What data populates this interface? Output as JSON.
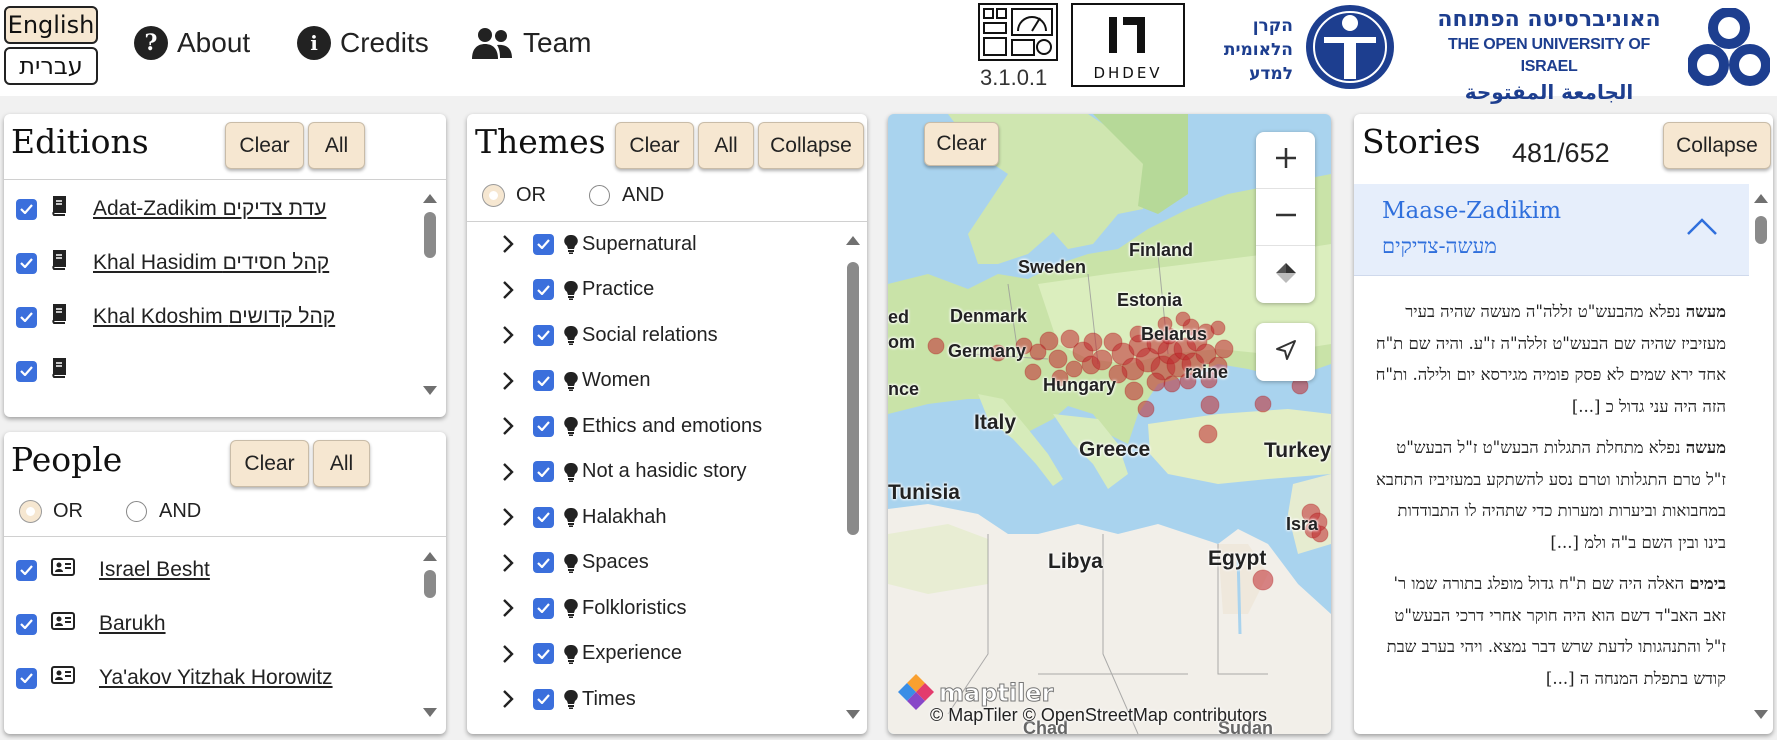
{
  "header": {
    "lang_english": "English",
    "lang_hebrew": "עברית",
    "nav": [
      {
        "label": "About",
        "icon": "question-circle-icon"
      },
      {
        "label": "Credits",
        "icon": "info-circle-icon"
      },
      {
        "label": "Team",
        "icon": "users-icon"
      }
    ],
    "version": "3.1.0.1",
    "dhdev_logo": "DHDEV",
    "isf_logo_lines": [
      "הקרן",
      "הלאומית",
      "למדע"
    ],
    "openu_logo": {
      "hebrew": "האוניברסיטה הפתוחה",
      "english": "THE OPEN UNIVERSITY OF ISRAEL",
      "arabic": "الجامعة المفتوحة"
    }
  },
  "editions": {
    "title": "Editions",
    "clear_label": "Clear",
    "all_label": "All",
    "items": [
      {
        "label": "Adat-Zadikim עדת צדיקים",
        "checked": true
      },
      {
        "label": "Khal Hasidim קהל חסידים",
        "checked": true
      },
      {
        "label": "Khal Kdoshim קהל קדושים",
        "checked": true
      },
      {
        "label": "",
        "checked": true
      }
    ]
  },
  "people": {
    "title": "People",
    "clear_label": "Clear",
    "all_label": "All",
    "or_label": "OR",
    "and_label": "AND",
    "mode": "OR",
    "items": [
      {
        "label": "Israel Besht",
        "checked": true
      },
      {
        "label": "Barukh",
        "checked": true
      },
      {
        "label": "Ya'akov Yitzhak Horowitz",
        "checked": true
      }
    ]
  },
  "themes": {
    "title": "Themes",
    "clear_label": "Clear",
    "all_label": "All",
    "collapse_label": "Collapse",
    "or_label": "OR",
    "and_label": "AND",
    "mode": "OR",
    "items": [
      {
        "label": "Supernatural",
        "checked": true
      },
      {
        "label": "Practice",
        "checked": true
      },
      {
        "label": "Social relations",
        "checked": true
      },
      {
        "label": "Women",
        "checked": true
      },
      {
        "label": "Ethics and emotions",
        "checked": true
      },
      {
        "label": "Not a hasidic story",
        "checked": true
      },
      {
        "label": "Halakhah",
        "checked": true
      },
      {
        "label": "Spaces",
        "checked": true
      },
      {
        "label": "Folkloristics",
        "checked": true
      },
      {
        "label": "Experience",
        "checked": true
      },
      {
        "label": "Times",
        "checked": true
      }
    ]
  },
  "map": {
    "clear_label": "Clear",
    "zoom_in": "+",
    "zoom_out": "−",
    "labels": [
      "Finland",
      "Sweden",
      "Estonia",
      "Denmark",
      "Germany",
      "Belarus",
      "Ukraine",
      "Hungary",
      "Italy",
      "Greece",
      "Turkey",
      "Tunisia",
      "Libya",
      "Egypt",
      "Israel",
      "France",
      "Chad",
      "Sudan"
    ],
    "label_fragments": {
      "France": "nce",
      "Ukraine": "raine",
      "Turkey": "Turkey",
      "Israel": "Isra",
      "Chad": "Chad",
      "Sudan": "Sudan",
      "left_edge_1": "ed",
      "left_edge_2": "om"
    },
    "attribution": "© MapTiler © OpenStreetMap contributors",
    "logo": "maptiler",
    "marker_color": "#c0282d"
  },
  "stories": {
    "title": "Stories",
    "count": "481/652",
    "collapse_label": "Collapse",
    "current": {
      "title_en": "Maase-Zadikim",
      "title_he": "מעשה-צדיקים"
    },
    "entries": [
      {
        "lead": "מעשה",
        "text": "נפלא מהבעש\"ט זללה\"ה מעשה שהיה בעיר מעזיביז שהיה שם הבעש\"ט זללה\"ה ז\"ע. והיה שם ת\"ח אחד ירא שמים לא פסק פומיה מגירסא יום ולילה. ות\"ח הזה היה עני גדול כ [...]"
      },
      {
        "lead": "מעשה",
        "text": "נפלא מתחלת התגלות הבעש\"ט ז\"ל הבעש\"ט ז\"ל טרם התגלותו וטרם נסע להשתקע במעזיביז התחבא במחבואות וביערות ומערות כדי שתהיה לו התבודדות בינו ובין השם ב\"ה ולמ [...]"
      },
      {
        "lead": "בימים",
        "text": "האלה היה שם ת\"ח גדול מופלג בתורה שמו ר' זאב האב\"ד דשם הוא היה חוקר אחרי דרכי הבעש\"ט ז\"ל והתנהגותו לדעת שרש דבר נמצא. ויהי בערב שבת קודש בתפלת המנחה ה [...]"
      }
    ]
  },
  "colors": {
    "accent_button": "#f6e7d1",
    "checkbox": "#3b6fdc",
    "story_header_bg": "#e6eefb",
    "story_title": "#2f6fdc"
  }
}
